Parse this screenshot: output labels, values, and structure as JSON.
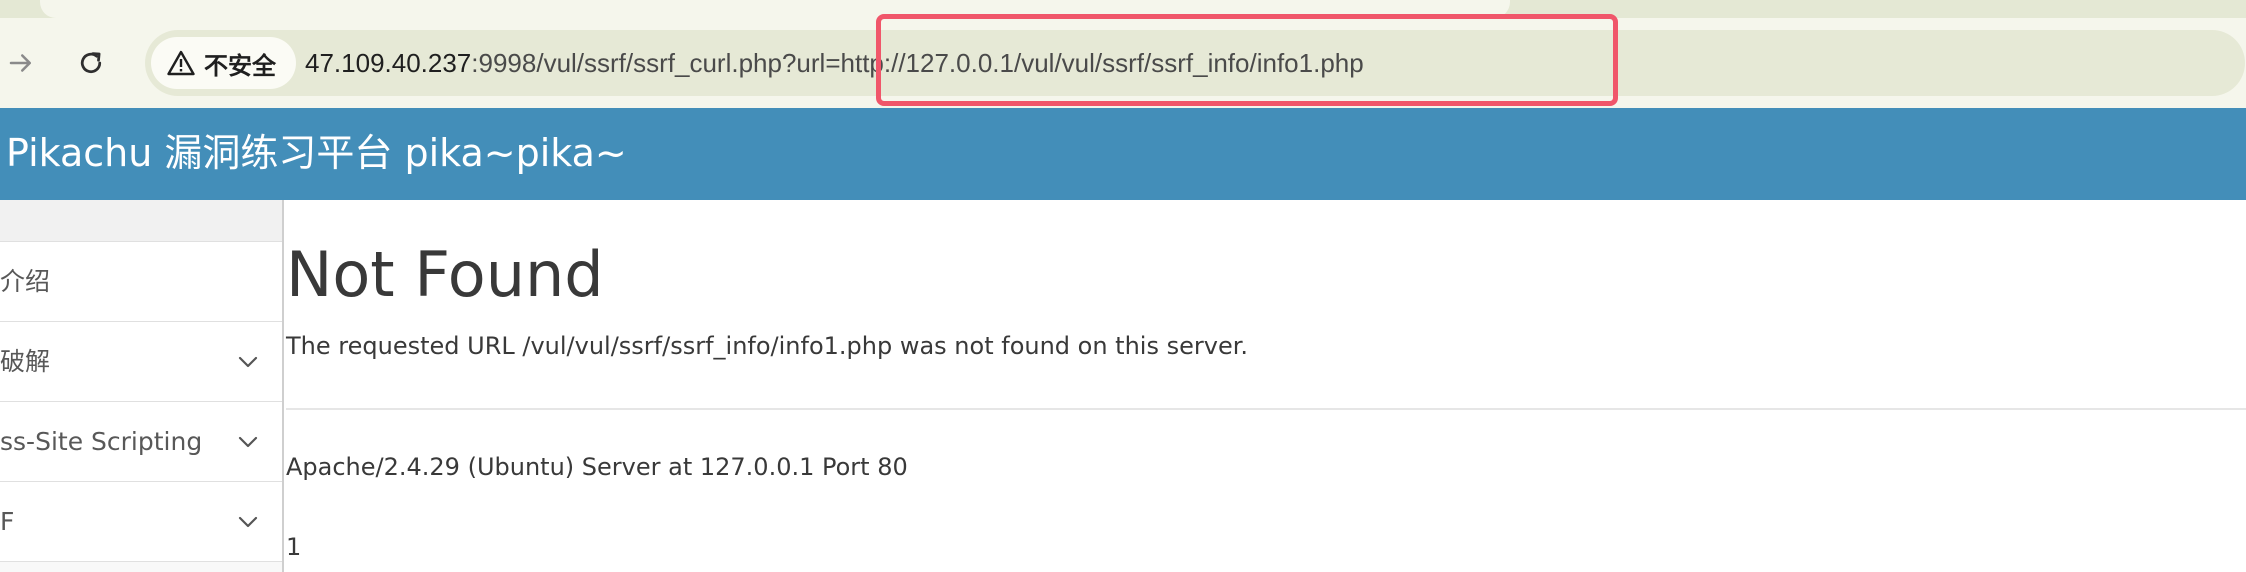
{
  "browser": {
    "security_label": "不安全",
    "security_icon": "warning-triangle-icon",
    "url_host": "47.109.40.237",
    "url_rest": ":9998/vul/ssrf/ssrf_curl.php?url=http://127.0.0.1/vul/vul/ssrf/ssrf_info/info1.php",
    "highlight_color": "#f0566a"
  },
  "header": {
    "title": "Pikachu 漏洞练习平台 pika~pika~",
    "background": "#438eb9"
  },
  "sidebar": {
    "items": [
      {
        "label": "介绍",
        "has_chevron": false
      },
      {
        "label": "破解",
        "has_chevron": true
      },
      {
        "label": "ss-Site Scripting",
        "has_chevron": true
      },
      {
        "label": "F",
        "has_chevron": true
      }
    ]
  },
  "content": {
    "heading": "Not Found",
    "message": "The requested URL /vul/vul/ssrf/ssrf_info/info1.php was not found on this server.",
    "server_signature": "Apache/2.4.29 (Ubuntu) Server at 127.0.0.1 Port 80",
    "output": "1"
  }
}
